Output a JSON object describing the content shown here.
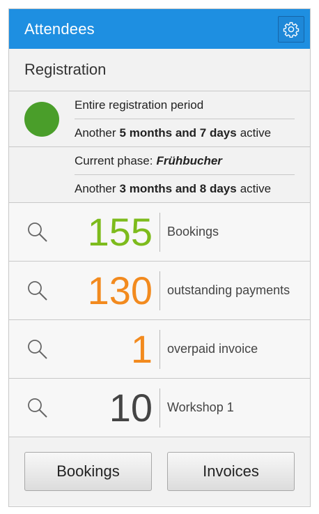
{
  "header": {
    "title": "Attendees",
    "settings_icon": "gear-icon"
  },
  "registration": {
    "title": "Registration",
    "status_color": "#4a9e2a",
    "period": {
      "label": "Entire registration period",
      "prefix": "Another",
      "duration": "5 months and 7 days",
      "suffix": "active"
    },
    "phase": {
      "label": "Current phase:",
      "name": "Frühbucher",
      "prefix": "Another",
      "duration": "3 months and 8 days",
      "suffix": "active"
    }
  },
  "stats": [
    {
      "value": "155",
      "label": "Bookings",
      "color": "#7dbb1c",
      "icon": "search-icon"
    },
    {
      "value": "130",
      "label": "outstanding payments",
      "color": "#f28a1e",
      "icon": "search-icon"
    },
    {
      "value": "1",
      "label": "overpaid invoice",
      "color": "#f28a1e",
      "icon": "search-icon"
    },
    {
      "value": "10",
      "label": "Workshop 1",
      "color": "#444444",
      "icon": "search-icon"
    }
  ],
  "footer": {
    "bookings_label": "Bookings",
    "invoices_label": "Invoices"
  },
  "colors": {
    "accent": "#1e8fe1"
  }
}
